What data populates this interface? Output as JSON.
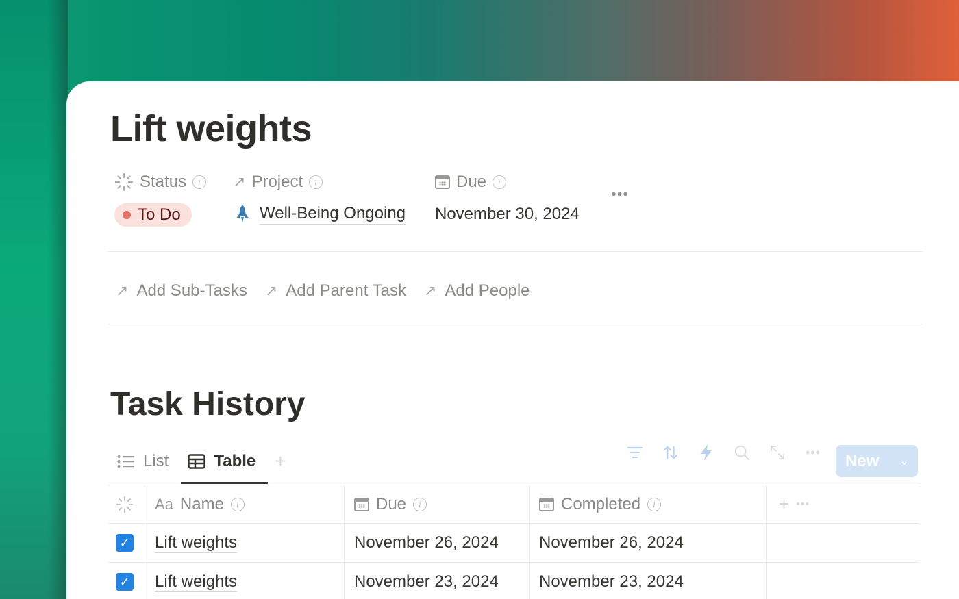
{
  "page": {
    "title": "Lift weights"
  },
  "properties": {
    "status": {
      "label": "Status",
      "value": "To Do",
      "dot_color": "#e16f64"
    },
    "project": {
      "label": "Project",
      "value": "Well-Being Ongoing",
      "icon": "rocket-icon"
    },
    "due": {
      "label": "Due",
      "value": "November 30, 2024"
    },
    "more": "•••"
  },
  "relations": [
    {
      "label": "Add Sub-Tasks"
    },
    {
      "label": "Add Parent Task"
    },
    {
      "label": "Add People"
    }
  ],
  "task_history": {
    "title": "Task History",
    "views": [
      {
        "label": "List",
        "active": false
      },
      {
        "label": "Table",
        "active": true
      }
    ],
    "add_view": "+",
    "toolbar": {
      "icons": [
        "filter-icon",
        "sort-icon",
        "automation-icon",
        "search-icon",
        "expand-icon",
        "more-icon"
      ],
      "new_label": "New",
      "accent": "#2383e2"
    },
    "table": {
      "columns": [
        {
          "label": "",
          "icon": "status-icon"
        },
        {
          "label": "Name",
          "icon": "text-icon",
          "prefix": "Aa"
        },
        {
          "label": "Due",
          "icon": "calendar-icon"
        },
        {
          "label": "Completed",
          "icon": "calendar-icon"
        }
      ],
      "rows": [
        {
          "done": true,
          "name": "Lift weights",
          "due": "November 26, 2024",
          "completed": "November 26, 2024"
        },
        {
          "done": true,
          "name": "Lift weights",
          "due": "November 23, 2024",
          "completed": "November 23, 2024"
        }
      ]
    }
  }
}
